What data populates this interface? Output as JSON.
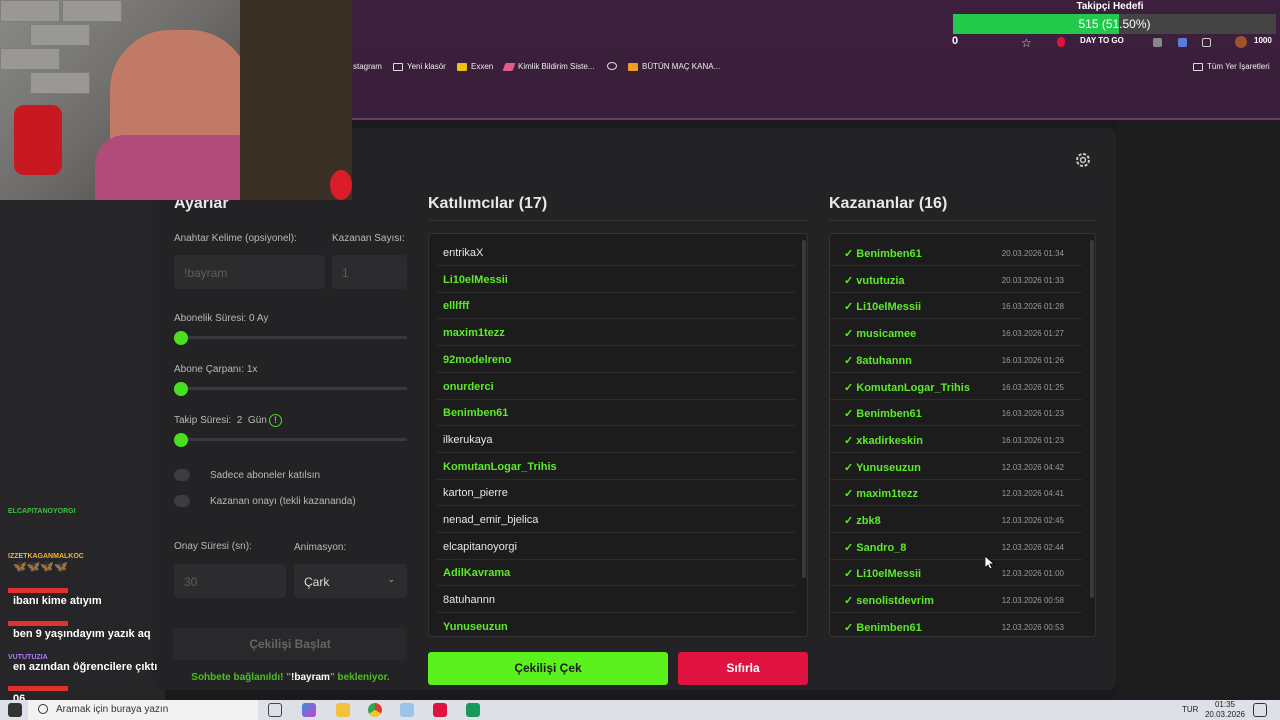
{
  "goal": {
    "title": "Takipçi Hedefi",
    "text": "515 (51.50%)",
    "progress": 0.515,
    "zero": "0",
    "end": "1000"
  },
  "browser": {
    "badge": "DAY TO GO",
    "bookmarks": [
      "stagram",
      "Yeni klasör",
      "Exxen",
      "Kimlik Bildirim Siste...",
      "BÜTÜN MAÇ KANA...",
      "Tüm Yer İşaretleri"
    ]
  },
  "settings": {
    "title": "Ayarlar",
    "keyword_label": "Anahtar Kelime (opsiyonel):",
    "keyword_placeholder": "!bayram",
    "winners_label": "Kazanan Sayısı:",
    "winners_value": "1",
    "sub_label": "Abonelik Süresi: 0 Ay",
    "multiplier_label": "Abone Çarpanı: 1x",
    "follow_label": "Takip Süresi:  2  Gün",
    "only_subs": "Sadece aboneler katılsın",
    "winner_confirm": "Kazanan onayı (tekli kazananda)",
    "confirm_time_label": "Onay Süresi (sn):",
    "confirm_time_value": "30",
    "animation_label": "Animasyon:",
    "animation_value": "Çark",
    "start_button": "Çekilişi Başlat",
    "status_prefix": "Sohbete bağlanıldı! \"",
    "status_keyword": "!bayram",
    "status_suffix": "\" bekleniyor."
  },
  "participants": {
    "title": "Katılımcılar (17)",
    "items": [
      {
        "name": "entrikaX",
        "sub": false
      },
      {
        "name": "Li10elMessii",
        "sub": true
      },
      {
        "name": "elllfff",
        "sub": true
      },
      {
        "name": "maxim1tezz",
        "sub": true
      },
      {
        "name": "92modelreno",
        "sub": true
      },
      {
        "name": "onurderci",
        "sub": true
      },
      {
        "name": "Benimben61",
        "sub": true
      },
      {
        "name": "ilkerukaya",
        "sub": false
      },
      {
        "name": "KomutanLogar_Trihis",
        "sub": true
      },
      {
        "name": "karton_pierre",
        "sub": false
      },
      {
        "name": "nenad_emir_bjelica",
        "sub": false
      },
      {
        "name": "elcapitanoyorgi",
        "sub": false
      },
      {
        "name": "AdilKavrama",
        "sub": true
      },
      {
        "name": "8atuhannn",
        "sub": false
      },
      {
        "name": "Yunuseuzun",
        "sub": true
      }
    ]
  },
  "winners": {
    "title": "Kazananlar (16)",
    "items": [
      {
        "name": "✓ Benimben61",
        "date": "20.03.2026 01:34"
      },
      {
        "name": "✓ vututuzia",
        "date": "20.03.2026 01:33"
      },
      {
        "name": "✓ Li10elMessii",
        "date": "16.03.2026 01:28"
      },
      {
        "name": "✓ musicamee",
        "date": "16.03.2026 01:27"
      },
      {
        "name": "✓ 8atuhannn",
        "date": "16.03.2026 01:26"
      },
      {
        "name": "✓ KomutanLogar_Trihis",
        "date": "16.03.2026 01:25"
      },
      {
        "name": "✓ Benimben61",
        "date": "16.03.2026 01:23"
      },
      {
        "name": "✓ xkadirkeskin",
        "date": "16.03.2026 01:23"
      },
      {
        "name": "✓ Yunuseuzun",
        "date": "12.03.2026 04:42"
      },
      {
        "name": "✓ maxim1tezz",
        "date": "12.03.2026 04:41"
      },
      {
        "name": "✓ zbk8",
        "date": "12.03.2026 02:45"
      },
      {
        "name": "✓ Sandro_8",
        "date": "12.03.2026 02:44"
      },
      {
        "name": "✓ Li10elMessii",
        "date": "12.03.2026 01:00"
      },
      {
        "name": "✓ senolistdevrim",
        "date": "12.03.2026 00:58"
      },
      {
        "name": "✓ Benimben61",
        "date": "12.03.2026 00:53"
      }
    ]
  },
  "buttons": {
    "draw": "Çekilişi Çek",
    "reset": "Sıfırla"
  },
  "chat": [
    {
      "user": "ELCAPITANOYORGI",
      "msg": "",
      "color": "#3ec13e"
    },
    {
      "user": "IZZETKAGANMALKOC",
      "msg": "🦋🦋🦋🦋",
      "color": "#f0b43c"
    },
    {
      "user": "",
      "msg": "ibanı kime atıyım",
      "color": "#e0302f"
    },
    {
      "user": "",
      "msg": "ben 9 yaşındayım yazık aq",
      "color": "#e0302f"
    },
    {
      "user": "VUTUTUZIA",
      "msg": "en azından öğrencilere çıktı",
      "color": "#b07aff"
    },
    {
      "user": "",
      "msg": "06",
      "color": "#e0302f"
    }
  ],
  "taskbar": {
    "search": "Aramak için buraya yazın",
    "lang": "TUR",
    "time": "01:35",
    "date": "20.03.2026"
  }
}
